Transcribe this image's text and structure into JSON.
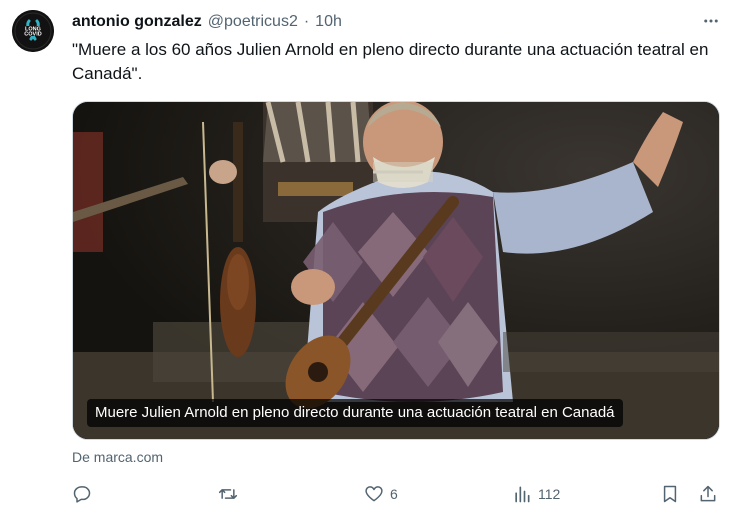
{
  "tweet": {
    "avatar_badge": "LONG COVID",
    "author_name": "antonio gonzalez",
    "author_handle": "@poetricus2",
    "separator": "·",
    "timestamp": "10h",
    "text": "\"Muere a los 60 años Julien Arnold en pleno directo durante una actuación teatral en Canadá\".",
    "more_icon": "more-horizontal-icon"
  },
  "card": {
    "caption": "Muere Julien Arnold en pleno directo durante una actuación teatral en Canadá",
    "source": "De marca.com"
  },
  "actions": {
    "reply_icon": "reply-icon",
    "retweet_icon": "retweet-icon",
    "like_icon": "heart-icon",
    "like_count": "6",
    "views_icon": "views-icon",
    "views_count": "112",
    "bookmark_icon": "bookmark-icon",
    "share_icon": "share-icon"
  },
  "colors": {
    "text_primary": "#0f1419",
    "text_secondary": "#536471",
    "border": "#cfd9de"
  }
}
